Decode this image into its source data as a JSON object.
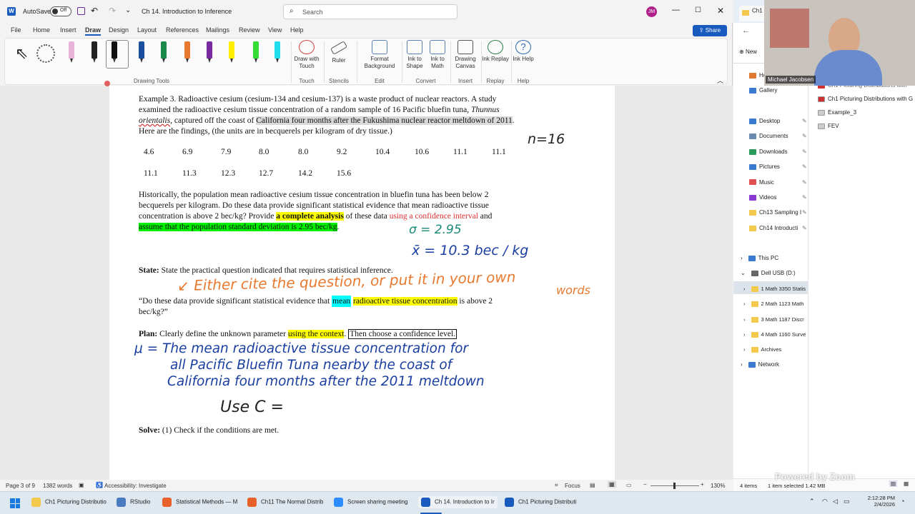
{
  "word": {
    "autosave_label": "AutoSave",
    "autosave_state": "Off",
    "doc_title": "Ch 14. Introduction to Inference",
    "search_placeholder": "Search",
    "user_initials": "JM",
    "share_label": "Share",
    "menus": [
      "File",
      "Home",
      "Insert",
      "Draw",
      "Design",
      "Layout",
      "References",
      "Mailings",
      "Review",
      "View",
      "Help"
    ],
    "active_menu": "Draw",
    "ribbon_groups": {
      "drawing_tools": "Drawing Tools",
      "touch": "Touch",
      "stencils": "Stencils",
      "edit": "Edit",
      "convert": "Convert",
      "insert": "Insert",
      "replay": "Replay",
      "help": "Help"
    },
    "ribbon_buttons": {
      "draw_with_touch": "Draw with Touch",
      "ruler": "Ruler",
      "format_background": "Format Background",
      "ink_to_shape": "Ink to Shape",
      "ink_to_math": "Ink to Math",
      "drawing_canvas": "Drawing Canvas",
      "ink_replay": "Ink Replay",
      "ink_help": "Ink Help"
    },
    "pen_colors": [
      "#e8b3d8",
      "#222222",
      "#111111",
      "#1a4fa0",
      "#1a8a4a",
      "#e87a30",
      "#7a2aa0",
      "#ffee00",
      "#33dd33",
      "#22ddee"
    ],
    "status": {
      "page": "Page 3 of 9",
      "words": "1382 words",
      "accessibility": "Accessibility: Investigate",
      "focus": "Focus",
      "zoom": "130%"
    }
  },
  "doc": {
    "example_line1": "Example 3.  Radioactive cesium (cesium-134 and cesium-137) is a waste product of nuclear reactors.  A study",
    "example_line2a": "examined the radioactive cesium tissue concentration of a random sample of 16 Pacific bluefin tuna, ",
    "example_line2b": "Thunnus",
    "example_line3a": "orientalis",
    "example_line3b": ", captured off the coast of ",
    "example_line3c": "California four months after the Fukushima nuclear reactor meltdown of 2011",
    "example_line3d": ".",
    "example_line4": "Here are the findings, (the units are in becquerels per kilogram of dry tissue.)",
    "data_row1": [
      "4.6",
      "6.9",
      "7.9",
      "8.0",
      "8.0",
      "9.2",
      "10.4",
      "10.6",
      "11.1",
      "11.1"
    ],
    "data_row2": [
      "11.1",
      "11.3",
      "12.3",
      "12.7",
      "14.2",
      "15.6"
    ],
    "hist_line1": "Historically, the population mean radioactive cesium tissue concentration in bluefin tuna has been below 2",
    "hist_line2": "becquerels per kilogram.  Do these data provide significant statistical evidence that mean radioactive tissue",
    "hist_line3a": "concentration is above 2 bec/kg?  Provide ",
    "hist_line3b": "a complete analysis",
    "hist_line3c": " of these data ",
    "hist_line3d": "using a confidence interval",
    "hist_line3e": " and",
    "hist_line4": "assume that the population standard deviation is 2.95 bec/kg",
    "hist_line4end": ".",
    "state_label": "State:",
    "state_text": "  State the practical question indicated that requires statistical inference.",
    "quote_a": "“Do these data provide significant statistical evidence that ",
    "quote_b": "mean",
    "quote_c": " ",
    "quote_d": "radioactive tissue concentration",
    "quote_e": " is above 2",
    "quote_line2": "bec/kg?”",
    "plan_label": "Plan:",
    "plan_a": "  Clearly define the unknown parameter ",
    "plan_b": "using the context",
    "plan_c": ".  ",
    "plan_d": "Then choose a confidence level.",
    "solve_label": "Solve:",
    "solve_text": "  (1) Check if the conditions are met."
  },
  "ink": {
    "n": "n=16",
    "sigma": "σ = 2.95",
    "xbar": "x̄ = 10.3 bec / kg",
    "either1": "↙ Either cite the question, or put it in your own",
    "either2": "words",
    "mu1": "μ = The mean radioactive tissue concentration for",
    "mu2": "all Pacific Bluefin Tuna   nearby   the coast of",
    "mu3": "California four months  after the 2011 meltdown",
    "usec": "Use C ="
  },
  "explorer": {
    "tab": "Ch1",
    "new_label": "New",
    "home": "Home",
    "gallery": "Gallery",
    "quick": [
      "Desktop",
      "Documents",
      "Downloads",
      "Pictures",
      "Music",
      "Videos",
      "Ch13 Sampling I",
      "Ch14 Introducti"
    ],
    "this_pc": "This PC",
    "usb": "Dell USB (D:)",
    "usb_folders": [
      "1 Math 3350 Statis",
      "2 Math 1123 Math",
      "3 Math 1187 Discr",
      "4 Math 1160 Surve",
      "Archives"
    ],
    "network": "Network",
    "files": [
      "Ch1  Picturing Distributions with G",
      "Example_3",
      "FEV"
    ],
    "file_top": "Ch1  Picturing Distributions with",
    "status_items": "4 items",
    "status_selected": "1 item selected  1.42 MB",
    "webcam_name": "Michael Jacobsen",
    "watermark": "Powered by Zoom"
  },
  "taskbar": {
    "items": [
      "Ch1 Picturing Distributio",
      "RStudio",
      "Statistical Methods — M",
      "Ch11 The Normal Distrib",
      "Screen sharing meeting",
      "Ch 14. Introduction to Ir",
      "Ch1  Picturing Distributi"
    ],
    "time": "2:12:28 PM",
    "date": "2/4/2026"
  }
}
